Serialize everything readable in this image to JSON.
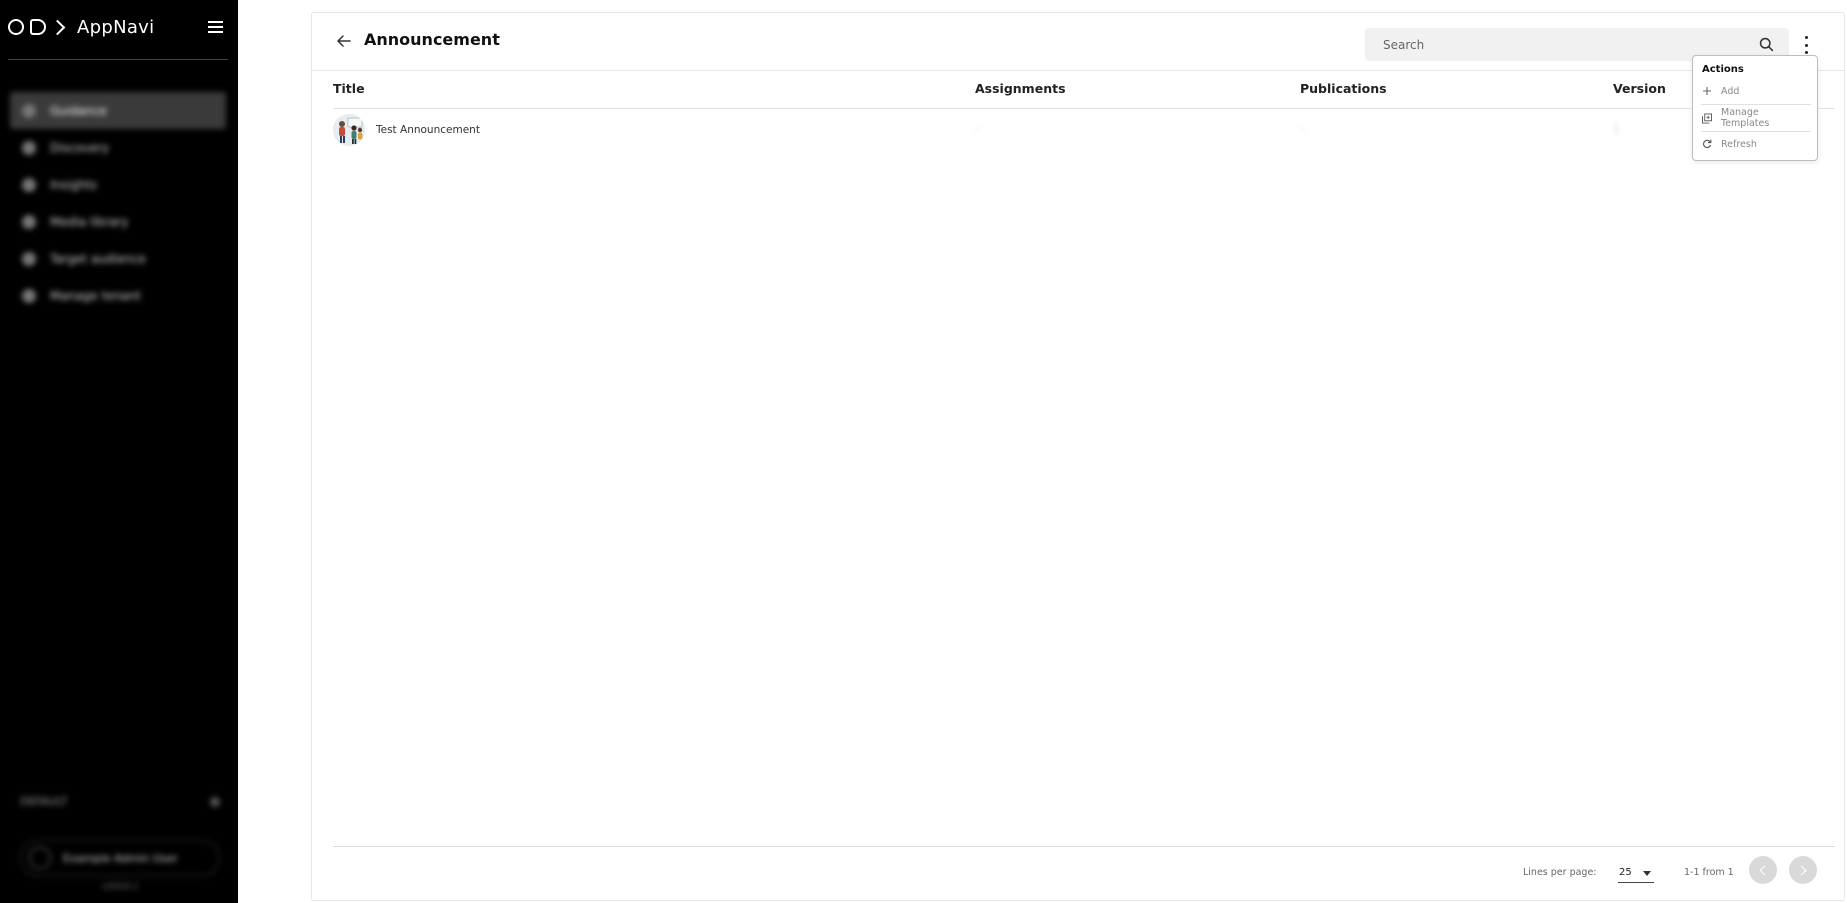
{
  "app": {
    "name": "AppNavi"
  },
  "sidebar": {
    "items": [
      {
        "label": "Guidance",
        "active": true
      },
      {
        "label": "Discovery",
        "active": false
      },
      {
        "label": "Insights",
        "active": false
      },
      {
        "label": "Media library",
        "active": false
      },
      {
        "label": "Target audience",
        "active": false
      },
      {
        "label": "Manage tenant",
        "active": false
      }
    ],
    "footer_label": "DEFAULT",
    "user_name": "Example Admin User",
    "version": "v2024.1"
  },
  "page": {
    "title": "Announcement",
    "search_placeholder": "Search"
  },
  "table": {
    "columns": [
      "Title",
      "Assignments",
      "Publications",
      "Version"
    ],
    "rows": [
      {
        "title": "Test Announcement",
        "assignments": "–",
        "publications": "–",
        "version": "1"
      }
    ]
  },
  "pagination": {
    "lines_per_page_label": "Lines per page:",
    "page_size": "25",
    "range_text": "1-1 from 1"
  },
  "actions_menu": {
    "title": "Actions",
    "items": [
      {
        "label": "Add",
        "icon": "plus-icon"
      },
      {
        "label": "Manage Templates",
        "icon": "templates-icon"
      },
      {
        "label": "Refresh",
        "icon": "refresh-icon"
      }
    ]
  },
  "colors": {
    "sidebar_bg": "#000000",
    "sidebar_active": "#3a3a3a",
    "search_bg": "#f1f1f1",
    "pager_button": "#d9d9d9"
  }
}
